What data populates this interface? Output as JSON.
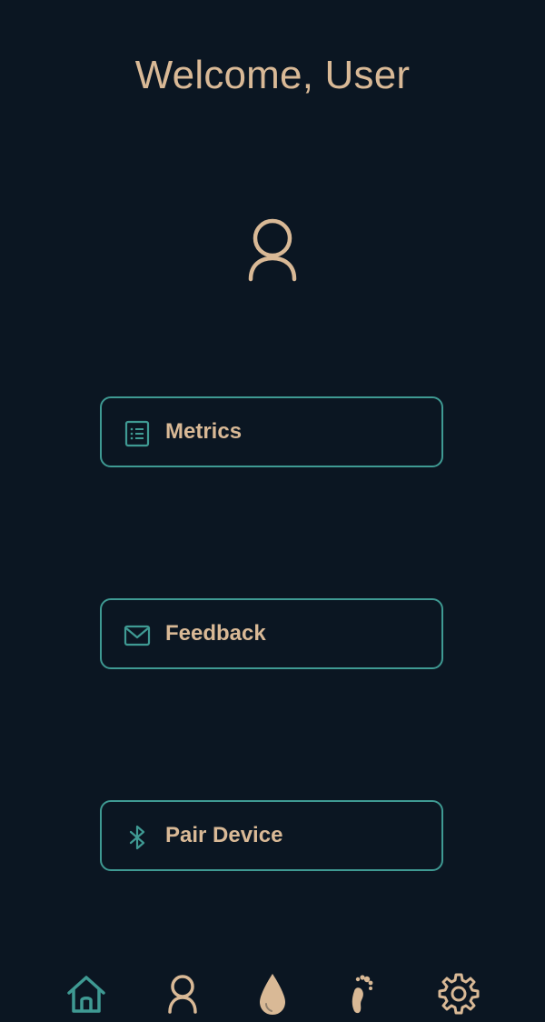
{
  "header": {
    "title": "Welcome, User"
  },
  "menu": {
    "metrics_label": "Metrics",
    "feedback_label": "Feedback",
    "pair_label": "Pair Device"
  },
  "icons": {
    "avatar": "user-icon",
    "metrics": "list-icon",
    "feedback": "envelope-icon",
    "pair": "bluetooth-icon",
    "tabs": [
      "home-icon",
      "user-icon",
      "drop-icon",
      "footprint-icon",
      "gear-icon"
    ]
  },
  "colors": {
    "background": "#0b1622",
    "accent_tan": "#d9b996",
    "accent_teal": "#3f9a93"
  }
}
